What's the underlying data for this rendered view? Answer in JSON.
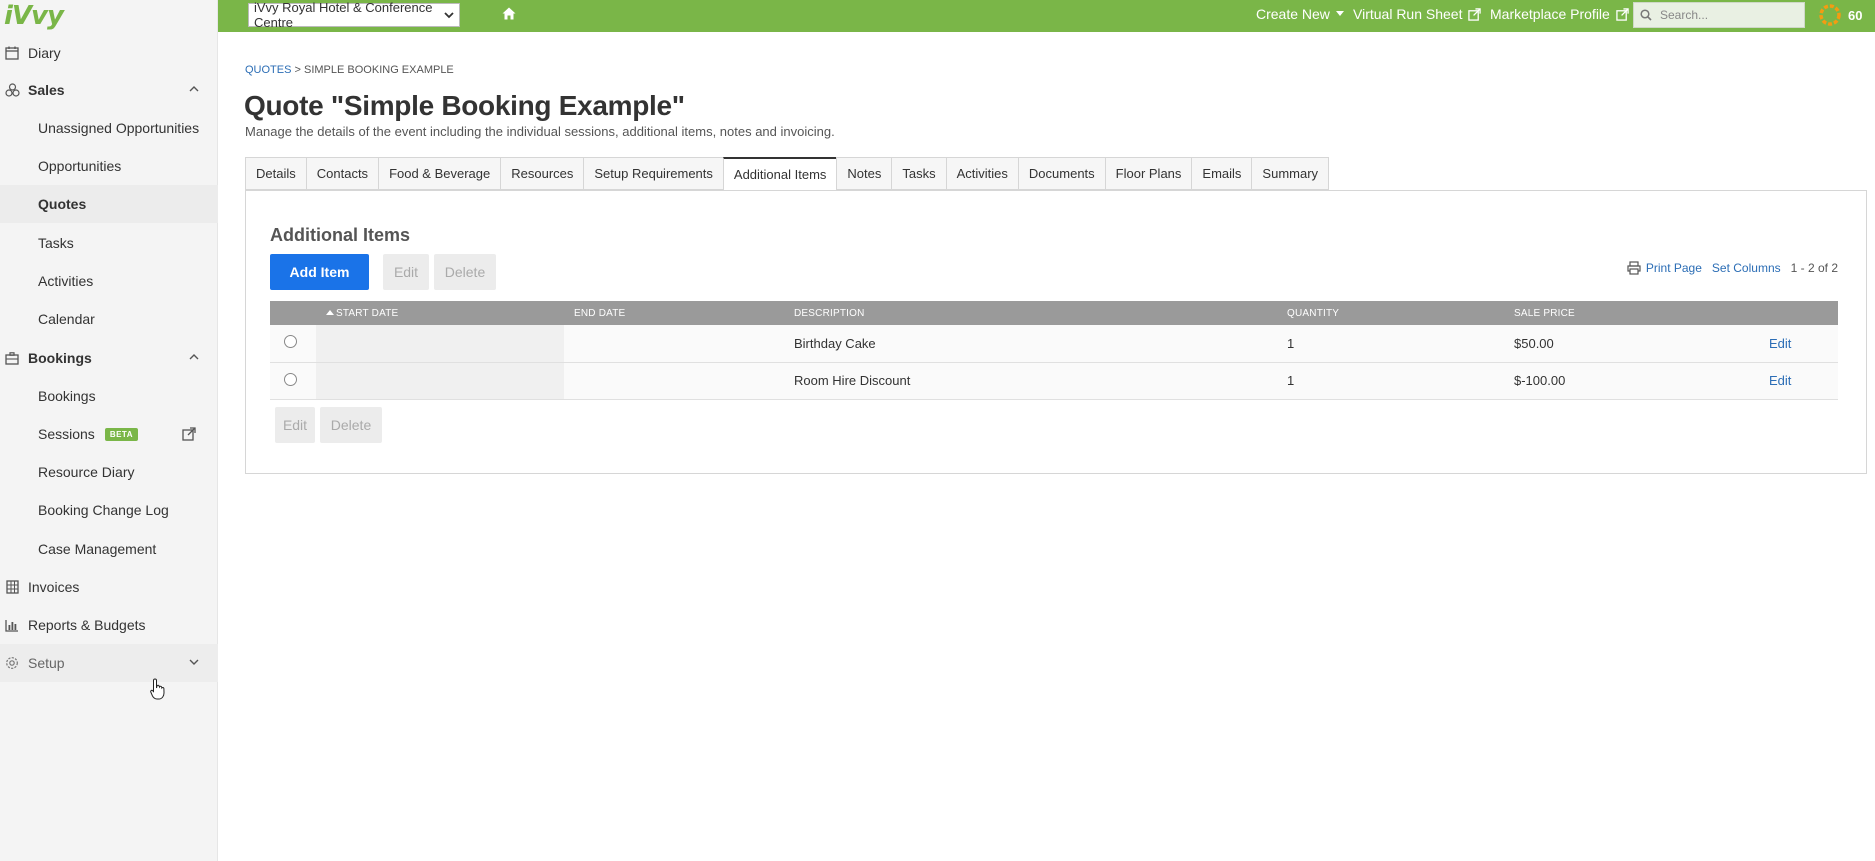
{
  "app": {
    "logo": "iVvy"
  },
  "sidebar": {
    "items": [
      {
        "label": "Diary",
        "icon": "calendar-icon"
      },
      {
        "label": "Sales",
        "icon": "sales-icon"
      },
      {
        "label": "Unassigned Opportunities"
      },
      {
        "label": "Opportunities"
      },
      {
        "label": "Quotes"
      },
      {
        "label": "Tasks"
      },
      {
        "label": "Activities"
      },
      {
        "label": "Calendar"
      },
      {
        "label": "Bookings",
        "icon": "briefcase-icon"
      },
      {
        "label": "Bookings"
      },
      {
        "label": "Sessions",
        "badge": "BETA"
      },
      {
        "label": "Resource Diary"
      },
      {
        "label": "Booking Change Log"
      },
      {
        "label": "Case Management"
      },
      {
        "label": "Invoices",
        "icon": "invoice-icon"
      },
      {
        "label": "Reports & Budgets",
        "icon": "bar-chart-icon"
      },
      {
        "label": "Setup",
        "icon": "gear-icon"
      }
    ]
  },
  "topbar": {
    "venue": "iVvy Royal Hotel & Conference Centre",
    "create_new": "Create New",
    "virtual_run_sheet": "Virtual Run Sheet",
    "marketplace_profile": "Marketplace Profile",
    "search_placeholder": "Search...",
    "score": "60",
    "brand_color": "#7ab648"
  },
  "breadcrumb": {
    "parent": "QUOTES",
    "separator": " > ",
    "current": "SIMPLE BOOKING EXAMPLE"
  },
  "page": {
    "title": "Quote \"Simple Booking Example\"",
    "subtitle": "Manage the details of the event including the individual sessions, additional items, notes and invoicing."
  },
  "tabs": [
    {
      "label": "Details"
    },
    {
      "label": "Contacts"
    },
    {
      "label": "Food & Beverage"
    },
    {
      "label": "Resources"
    },
    {
      "label": "Setup Requirements"
    },
    {
      "label": "Additional Items"
    },
    {
      "label": "Notes"
    },
    {
      "label": "Tasks"
    },
    {
      "label": "Activities"
    },
    {
      "label": "Documents"
    },
    {
      "label": "Floor Plans"
    },
    {
      "label": "Emails"
    },
    {
      "label": "Summary"
    }
  ],
  "active_tab": "Additional Items",
  "panel": {
    "title": "Additional Items",
    "add_label": "Add Item",
    "edit_label": "Edit",
    "delete_label": "Delete",
    "print_label": "Print Page",
    "set_columns_label": "Set Columns",
    "count_label": "1 - 2 of 2"
  },
  "table": {
    "columns": [
      "Start Date",
      "End Date",
      "Description",
      "Quantity",
      "Sale Price"
    ],
    "rows": [
      {
        "start": "",
        "end": "",
        "description": "Birthday Cake",
        "quantity": "1",
        "price": "$50.00",
        "action": "Edit"
      },
      {
        "start": "",
        "end": "",
        "description": "Room Hire Discount",
        "quantity": "1",
        "price": "$-100.00",
        "action": "Edit"
      }
    ]
  }
}
